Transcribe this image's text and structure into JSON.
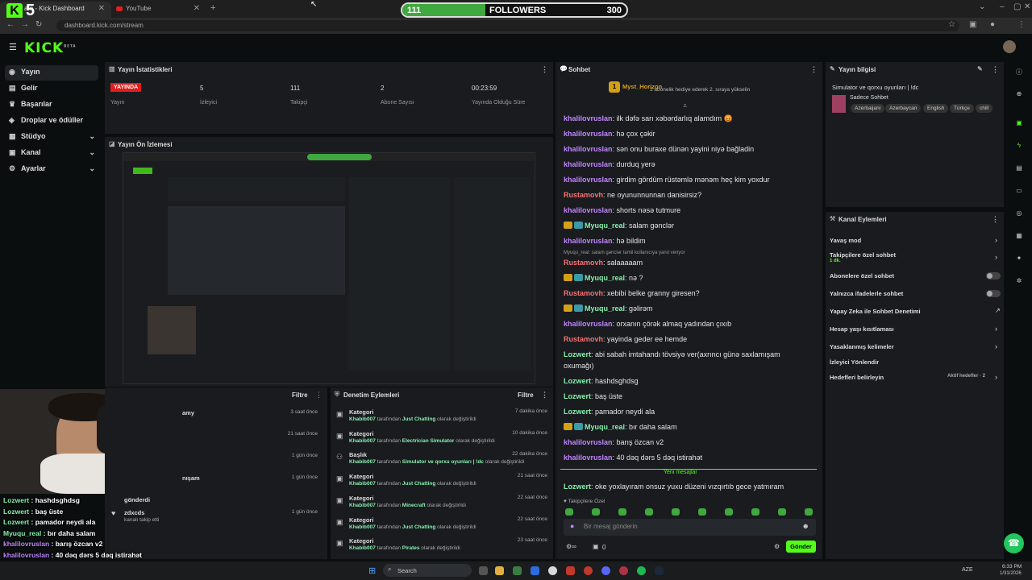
{
  "browser": {
    "tabs": [
      {
        "label": "am - Kick Dashboard"
      },
      {
        "label": "YouTube"
      }
    ],
    "new_tab": "+",
    "url": "dashboard.kick.com/stream"
  },
  "overlay": {
    "logo_number": "5",
    "followers_current": "111",
    "followers_label": "FOLLOWERS",
    "followers_goal": "300",
    "followers_progress": 0.37
  },
  "kick": {
    "logo": "KICK",
    "logo_sup": "BETA"
  },
  "sidebar": {
    "items": [
      {
        "label": "Yayın",
        "icon": "broadcast-icon",
        "glyph": "◉"
      },
      {
        "label": "Gelir",
        "icon": "income-icon",
        "glyph": "▤"
      },
      {
        "label": "Başarılar",
        "icon": "trophy-icon",
        "glyph": "♛"
      },
      {
        "label": "Droplar ve ödüller",
        "icon": "gift-icon",
        "glyph": "◈"
      },
      {
        "label": "Stüdyo",
        "icon": "studio-icon",
        "glyph": "▦",
        "chevron": "⌄"
      },
      {
        "label": "Kanal",
        "icon": "channel-icon",
        "glyph": "▣",
        "chevron": "⌄"
      },
      {
        "label": "Ayarlar",
        "icon": "gear-icon",
        "glyph": "⚙",
        "chevron": "⌄"
      }
    ]
  },
  "stats": {
    "title": "Yayın İstatistikleri",
    "live_badge": "YAYINDA",
    "items": [
      {
        "value": "",
        "label": "Yayın"
      },
      {
        "value": "5",
        "label": "İzleyici"
      },
      {
        "value": "111",
        "label": "Takipçi"
      },
      {
        "value": "2",
        "label": "Abone Sayısı"
      },
      {
        "value": "00:23:59",
        "label": "Yayında Olduğu Süre"
      }
    ]
  },
  "preview": {
    "title": "Yayın Ön İzlemesi"
  },
  "activity": {
    "filter": "Filtre",
    "items": [
      {
        "text": "amy",
        "time": "3 saat önce"
      },
      {
        "text": "",
        "time": "21 saat önce"
      },
      {
        "text": "",
        "time": "1 gün önce"
      },
      {
        "text": "nışam",
        "time": "1 gün önce"
      },
      {
        "text": "gönderdi",
        "time": ""
      },
      {
        "text": "zdxcds",
        "sub": "kanalı takip etti",
        "time": "1 gün önce"
      }
    ]
  },
  "mod_events": {
    "title": "Denetim Eylemleri",
    "filter": "Filtre",
    "by": "tarafından",
    "suffix": "olarak değiştirildi",
    "items": [
      {
        "type": "Kategori",
        "user": "Khabib007",
        "value": "Just Chatting",
        "time": "7 dakika önce"
      },
      {
        "type": "Kategori",
        "user": "Khabib007",
        "value": "Electrician Simulator",
        "time": "10 dakika önce"
      },
      {
        "type": "Başlık",
        "user": "Khabib007",
        "value": "Simulator ve qorxu oyunları | !dc",
        "time": "22 dakika önce"
      },
      {
        "type": "Kategori",
        "user": "Khabib007",
        "value": "Just Chatting",
        "time": "21 saat önce"
      },
      {
        "type": "Kategori",
        "user": "Khabib007",
        "value": "Minecraft",
        "time": "22 saat önce"
      },
      {
        "type": "Kategori",
        "user": "Khabib007",
        "value": "Just Chatting",
        "time": "22 saat önce"
      },
      {
        "type": "Kategori",
        "user": "Khabib007",
        "value": "Pirates",
        "time": "23 saat önce"
      }
    ]
  },
  "chat": {
    "title": "Sohbet",
    "pinned_user": "Myst_Horizon",
    "pinned_text": "1 abonelik hediye ederek 2. sıraya yükselin",
    "pinned_count": "1",
    "messages": [
      {
        "user": "khalilovruslan",
        "color": "p",
        "text": "ilk dəfə sarı xəbərdarlıq alamdım 😡"
      },
      {
        "user": "khalilovruslan",
        "color": "p",
        "text": "hə çox çəkir"
      },
      {
        "user": "khalilovruslan",
        "color": "p",
        "text": "sən onu buraxe dünən yayini niyə bağladin"
      },
      {
        "user": "khalilovruslan",
        "color": "p",
        "text": "durduq yerə"
      },
      {
        "user": "khalilovruslan",
        "color": "p",
        "text": "girdim gördüm rüstəmlə mənəm heç kim yoxdur"
      },
      {
        "user": "Rustamovh",
        "color": "r",
        "text": "ne oyununnunnan danisirsiz?"
      },
      {
        "user": "khalilovruslan",
        "color": "p",
        "text": "shorts nəsə tutmure"
      },
      {
        "user": "Myuqu_real",
        "color": "g",
        "badges": true,
        "text": "salam gənclər"
      },
      {
        "user": "khalilovruslan",
        "color": "p",
        "text": "hə bildim"
      },
      {
        "reply": "Myuqu_real: salam gənclər tamil kullanıcıya yanıt veriyor"
      },
      {
        "user": "Rustamovh",
        "color": "r",
        "text": "salaaaaam"
      },
      {
        "user": "Myuqu_real",
        "color": "g",
        "badges": true,
        "text": "nə ?"
      },
      {
        "user": "Rustamovh",
        "color": "r",
        "text": "xebibi belke granny giresen?"
      },
      {
        "user": "Myuqu_real",
        "color": "g",
        "badges": true,
        "text": "gəlirəm"
      },
      {
        "user": "khalilovruslan",
        "color": "p",
        "text": "orxanın çörək almaq yadından çıxıb"
      },
      {
        "user": "Rustamovh",
        "color": "r",
        "text": "yayinda geder ee hemde"
      },
      {
        "user": "Lozwert",
        "color": "g",
        "text": "abi sabah imtahandı tövsiyə ver(axrıncı günə saxlamışam"
      },
      {
        "cont": "oxumağı)"
      },
      {
        "user": "Lozwert",
        "color": "g",
        "text": "hashdsghdsg"
      },
      {
        "user": "Lozwert",
        "color": "g",
        "text": "baş üste"
      },
      {
        "user": "Lozwert",
        "color": "g",
        "text": "pamador neydi ala"
      },
      {
        "user": "Myuqu_real",
        "color": "g",
        "badges": true,
        "text": "bır daha salam"
      },
      {
        "user": "khalilovruslan",
        "color": "p",
        "text": "barış özcan v2"
      },
      {
        "user": "khalilovruslan",
        "color": "p",
        "text": "40 dəq dərs 5 dəq istirahət"
      }
    ],
    "new_messages": "Yeni mesajlar",
    "last_message": {
      "user": "Lozwert",
      "text": "oke yoxlayıram onsuz yuxu düzeni vızqırtıb gece yatmıram"
    },
    "followers_only": "Takipçilere Özel",
    "input_placeholder": "Bir mesaj gönderin",
    "count": "0",
    "send": "Gönder"
  },
  "stream_info": {
    "title": "Yayın bilgisi",
    "stream_title": "Simulator ve qorxu oyunları | !dc",
    "category": "Sadece Sohbet",
    "tags": [
      "Azerbaijani",
      "Azerbaycan",
      "English",
      "Türkçe",
      "chill"
    ]
  },
  "channel_actions": {
    "title": "Kanal Eylemleri",
    "items": [
      {
        "label": "Yavaş mod",
        "control": "arrow"
      },
      {
        "label": "Takipçilere özel sohbet",
        "sub": "1 dk.",
        "control": "arrow"
      },
      {
        "label": "Abonelere özel sohbet",
        "control": "toggle"
      },
      {
        "label": "Yalnızca ifadelerle sohbet",
        "control": "toggle"
      },
      {
        "label": "Yapay Zeka ile Sohbet Denetimi",
        "control": "link"
      },
      {
        "label": "Hesap yaşı kısıtlaması",
        "control": "arrow"
      },
      {
        "label": "Yasaklanmış kelimeler",
        "control": "arrow"
      },
      {
        "label": "İzleyici Yönlendir",
        "control": "none"
      },
      {
        "label": "Hedefleri belirleyin",
        "sub": "Aktif hedefler · 2",
        "control": "arrow"
      }
    ]
  },
  "webcam_chat": [
    {
      "user": "Lozwert",
      "color": "g",
      "text": "hashdsghdsg"
    },
    {
      "user": "Lozwert",
      "color": "g",
      "text": "baş üste"
    },
    {
      "user": "Lozwert",
      "color": "g",
      "text": "pamador neydi ala"
    },
    {
      "user": "Myuqu_real",
      "color": "g",
      "text": "bır daha salam"
    },
    {
      "user": "khalilovruslan",
      "color": "p",
      "text": "barış özcan v2"
    },
    {
      "user": "khalilovruslan",
      "color": "p",
      "text": "40 dəq dərs 5 dəq istirahət"
    },
    {
      "user": "Lozwert",
      "color": "g",
      "text": "oke yoxlayıram onsuz yuxu düzeni vızqırtıb gece yatmıram"
    }
  ],
  "taskbar": {
    "search": "Search",
    "lang": "AZE",
    "time": "6:33 PM",
    "date": "1/31/2026"
  },
  "colors": {
    "kick_green": "#53fc18",
    "live_red": "#e11d1d",
    "panel_bg": "#191b1f"
  }
}
